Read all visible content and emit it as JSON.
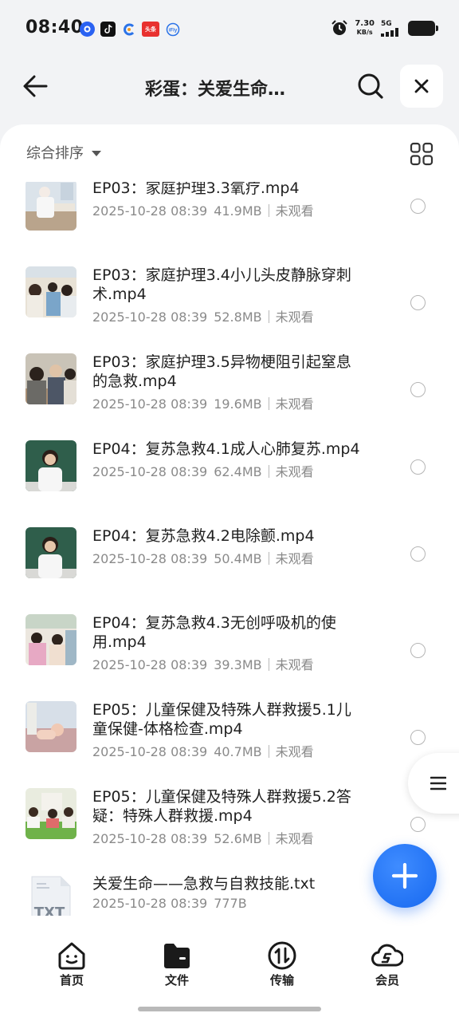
{
  "status_bar": {
    "time": "08:40",
    "net_speed_value": "7.30",
    "net_speed_unit": "KB/s",
    "network": "5G",
    "app_icons": [
      "baidu-app-icon",
      "tiktok-icon",
      "browser-icon",
      "toutiao-icon",
      "ifly-icon"
    ],
    "toutiao_text": "头条"
  },
  "header": {
    "title": "彩蛋：关爱生命…"
  },
  "toolbar": {
    "sort_label": "综合排序"
  },
  "files": [
    {
      "name": "EP03：家庭护理3.3氧疗.mp4",
      "date": "2025-10-28 08:39",
      "size": "41.9MB",
      "status": "未观看",
      "thumb": "nurse"
    },
    {
      "name": "EP03：家庭护理3.4小儿头皮静脉穿刺术.mp4",
      "date": "2025-10-28 08:39",
      "size": "52.8MB",
      "status": "未观看",
      "thumb": "class"
    },
    {
      "name": "EP03：家庭护理3.5异物梗阻引起窒息的急救.mp4",
      "date": "2025-10-28 08:39",
      "size": "19.6MB",
      "status": "未观看",
      "thumb": "class2"
    },
    {
      "name": "EP04：复苏急救4.1成人心肺复苏.mp4",
      "date": "2025-10-28 08:39",
      "size": "62.4MB",
      "status": "未观看",
      "thumb": "lecturer"
    },
    {
      "name": "EP04：复苏急救4.2电除颤.mp4",
      "date": "2025-10-28 08:39",
      "size": "50.4MB",
      "status": "未观看",
      "thumb": "lecturer"
    },
    {
      "name": "EP04：复苏急救4.3无创呼吸机的使用.mp4",
      "date": "2025-10-28 08:39",
      "size": "39.3MB",
      "status": "未观看",
      "thumb": "class3"
    },
    {
      "name": "EP05：儿童保健及特殊人群救援5.1儿童保健-体格检查.mp4",
      "date": "2025-10-28 08:39",
      "size": "40.7MB",
      "status": "未观看",
      "thumb": "baby"
    },
    {
      "name": "EP05：儿童保健及特殊人群救援5.2答疑：特殊人群救援.mp4",
      "date": "2025-10-28 08:39",
      "size": "52.6MB",
      "status": "未观看",
      "thumb": "panel"
    },
    {
      "name": "关爱生命——急救与自救技能.txt",
      "date": "2025-10-28 08:39",
      "size": "777B",
      "status": "",
      "thumb": "txt"
    }
  ],
  "txt_label": "TXT",
  "bottom_nav": [
    {
      "label": "首页",
      "icon": "home-smile-icon"
    },
    {
      "label": "文件",
      "icon": "folder-icon"
    },
    {
      "label": "传输",
      "icon": "transfer-icon"
    },
    {
      "label": "会员",
      "icon": "cloud-member-icon"
    }
  ],
  "colors": {
    "accent": "#1668f0",
    "meta_text": "#8a8a8a",
    "background": "#f2f3f5"
  }
}
